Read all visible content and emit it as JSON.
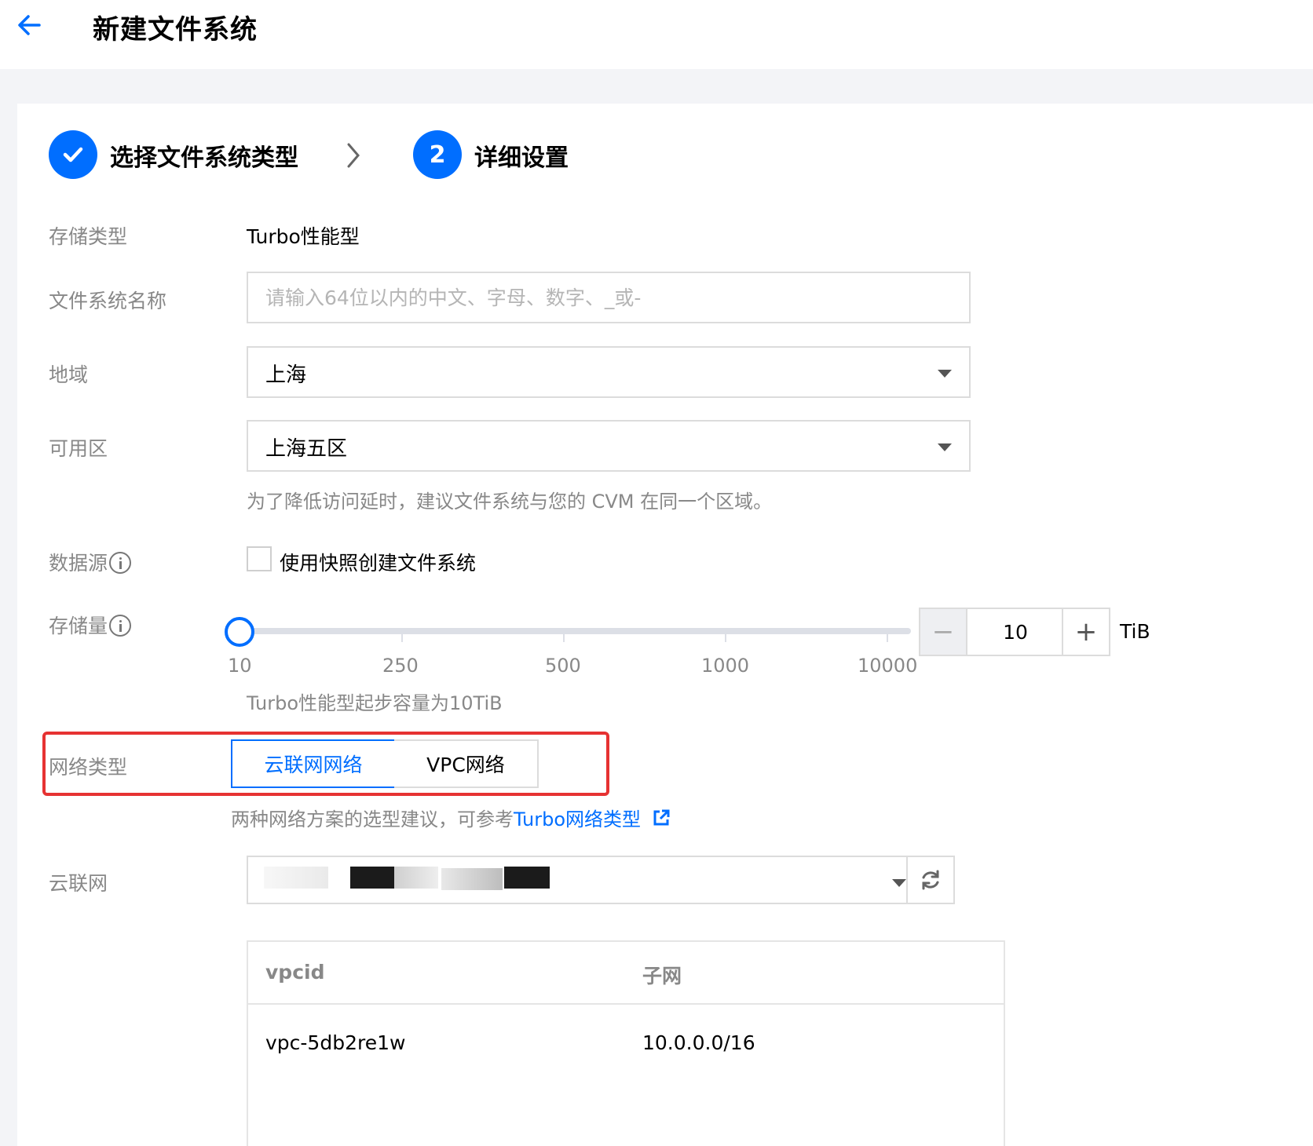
{
  "page": {
    "title": "新建文件系统"
  },
  "steps": [
    {
      "label": "选择文件系统类型",
      "status": "done"
    },
    {
      "number": "2",
      "label": "详细设置",
      "status": "active"
    }
  ],
  "form": {
    "storage_type": {
      "label": "存储类型",
      "value": "Turbo性能型"
    },
    "fs_name": {
      "label": "文件系统名称",
      "value": "",
      "placeholder": "请输入64位以内的中文、字母、数字、_或-"
    },
    "region": {
      "label": "地域",
      "value": "上海"
    },
    "zone": {
      "label": "可用区",
      "value": "上海五区",
      "hint": "为了降低访问延时，建议文件系统与您的 CVM 在同一个区域。"
    },
    "data_source": {
      "label": "数据源",
      "checkbox_label": "使用快照创建文件系统"
    },
    "capacity": {
      "label": "存储量",
      "ticks": [
        "10",
        "250",
        "500",
        "1000",
        "10000"
      ],
      "value": "10",
      "unit": "TiB",
      "minus": "−",
      "plus": "+",
      "hint": "Turbo性能型起步容量为10TiB"
    },
    "network_type": {
      "label": "网络类型",
      "options": [
        "云联网网络",
        "VPC网络"
      ],
      "selected": "云联网网络",
      "hint_prefix": "两种网络方案的选型建议，可参考",
      "hint_link": "Turbo网络类型"
    },
    "ccn": {
      "label": "云联网"
    }
  },
  "vpc_table": {
    "columns": [
      "vpcid",
      "子网"
    ],
    "rows": [
      [
        "vpc-5db2re1w",
        "10.0.0.0/16"
      ]
    ]
  },
  "colors": {
    "accent": "#006eff",
    "highlight": "#e63232"
  }
}
